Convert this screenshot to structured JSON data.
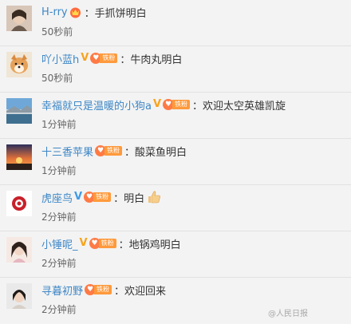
{
  "comments": [
    {
      "user": "H-rry",
      "text": "手抓饼明白",
      "time": "50秒前"
    },
    {
      "user": "吖小蓝h",
      "text": "牛肉丸明白",
      "time": "50秒前",
      "fan_label": "铁粉"
    },
    {
      "user": "幸福就只是温暖的小狗a",
      "text": "欢迎太空英雄凯旋",
      "time": "1分钟前",
      "fan_label": "铁粉"
    },
    {
      "user": "十三香苹果",
      "text": "酸菜鱼明白",
      "time": "1分钟前",
      "fan_label": "铁粉"
    },
    {
      "user": "虎座鸟",
      "text": "明白",
      "time": "2分钟前",
      "fan_label": "铁粉"
    },
    {
      "user": "小锤呢_",
      "text": "地锅鸡明白",
      "time": "2分钟前",
      "fan_label": "铁粉"
    },
    {
      "user": "寻暮初野",
      "text": "欢迎回来",
      "time": "2分钟前",
      "fan_label": "铁粉"
    }
  ],
  "separator": "：",
  "watermark": "@人民日报",
  "colors": {
    "username": "#3e87c6",
    "text": "#333333",
    "time": "#666666",
    "background": "#f3f3f3",
    "fan_badge": "#ff9a3c",
    "verified_orange": "#f7a41d",
    "verified_blue": "#3e9be8"
  }
}
